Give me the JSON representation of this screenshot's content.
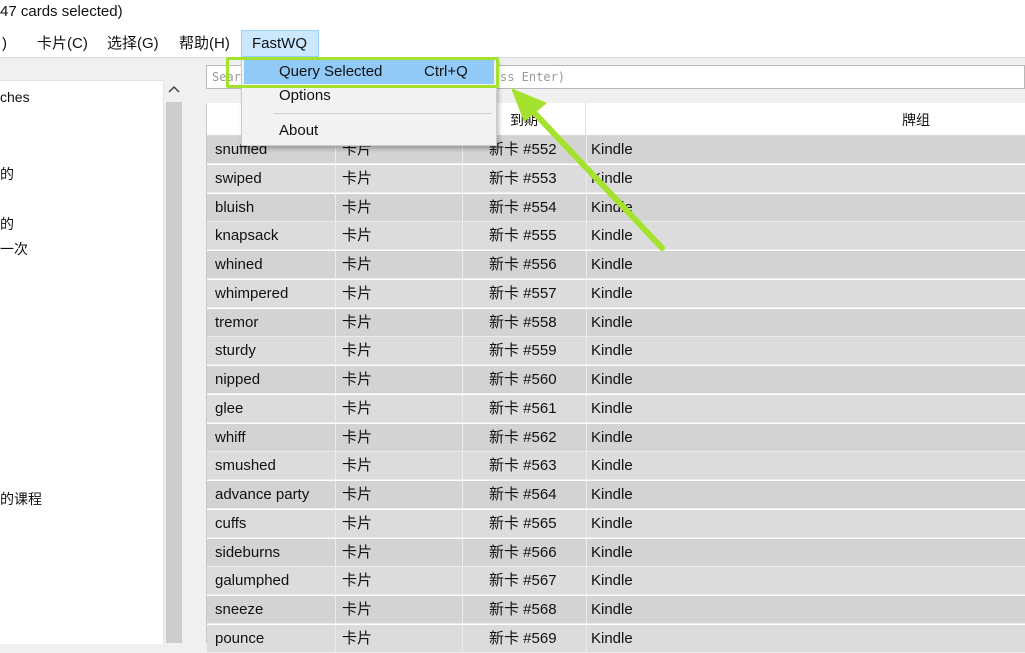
{
  "window": {
    "title": "47 cards selected)"
  },
  "menubar": {
    "items": [
      {
        "label": ")"
      },
      {
        "label": "卡片(C)"
      },
      {
        "label": "选择(G)"
      },
      {
        "label": "帮助(H)"
      },
      {
        "label": "FastWQ",
        "active": true
      }
    ]
  },
  "dropdown": {
    "items": [
      {
        "label": "Query Selected",
        "shortcut": "Ctrl+Q",
        "highlighted": true
      },
      {
        "label": "Options"
      },
      {
        "label": "About"
      }
    ]
  },
  "sidebar": {
    "texts": [
      "ches",
      "的",
      "的",
      "一次",
      "的课程"
    ]
  },
  "search": {
    "visible_left": "Sear",
    "visible_right": "ss Enter)"
  },
  "table": {
    "headers": [
      "到期",
      "牌组"
    ],
    "rows": [
      [
        "snuffled",
        "卡片",
        "新卡 #552",
        "Kindle"
      ],
      [
        "swiped",
        "卡片",
        "新卡 #553",
        "Kindle"
      ],
      [
        "bluish",
        "卡片",
        "新卡 #554",
        "Kindle"
      ],
      [
        "knapsack",
        "卡片",
        "新卡 #555",
        "Kindle"
      ],
      [
        "whined",
        "卡片",
        "新卡 #556",
        "Kindle"
      ],
      [
        "whimpered",
        "卡片",
        "新卡 #557",
        "Kindle"
      ],
      [
        "tremor",
        "卡片",
        "新卡 #558",
        "Kindle"
      ],
      [
        "sturdy",
        "卡片",
        "新卡 #559",
        "Kindle"
      ],
      [
        "nipped",
        "卡片",
        "新卡 #560",
        "Kindle"
      ],
      [
        "glee",
        "卡片",
        "新卡 #561",
        "Kindle"
      ],
      [
        "whiff",
        "卡片",
        "新卡 #562",
        "Kindle"
      ],
      [
        "smushed",
        "卡片",
        "新卡 #563",
        "Kindle"
      ],
      [
        "advance party",
        "卡片",
        "新卡 #564",
        "Kindle"
      ],
      [
        "cuffs",
        "卡片",
        "新卡 #565",
        "Kindle"
      ],
      [
        "sideburns",
        "卡片",
        "新卡 #566",
        "Kindle"
      ],
      [
        "galumphed",
        "卡片",
        "新卡 #567",
        "Kindle"
      ],
      [
        "sneeze",
        "卡片",
        "新卡 #568",
        "Kindle"
      ],
      [
        "pounce",
        "卡片",
        "新卡 #569",
        "Kindle"
      ]
    ]
  },
  "colors": {
    "annotation": "#a5e22e",
    "menu_highlight": "#91c9f7",
    "active_menu": "#cce8ff",
    "row_bg": "#d3d3d3"
  },
  "icons": {
    "scroll_up": "chevron-up-icon",
    "annotation_arrow": "arrow-icon"
  }
}
